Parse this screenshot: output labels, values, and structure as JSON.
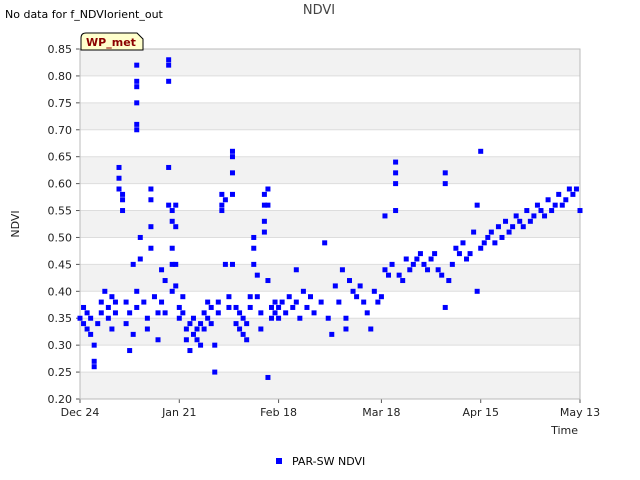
{
  "notice": "No data for f_NDVIorient_out",
  "badge": "WP_met",
  "colors": {
    "series": "#0000ff",
    "band": "#f2f2f2",
    "grid": "#dddddd",
    "badge_bg": "#ffffcc"
  },
  "chart_data": {
    "type": "scatter",
    "title": "NDVI",
    "xlabel": "Time",
    "ylabel": "NDVI",
    "ylim": [
      0.2,
      0.85
    ],
    "yticks": [
      "0.20",
      "0.25",
      "0.30",
      "0.35",
      "0.40",
      "0.45",
      "0.50",
      "0.55",
      "0.60",
      "0.65",
      "0.70",
      "0.75",
      "0.80",
      "0.85"
    ],
    "xlim": [
      "2023-12-24",
      "2024-05-13"
    ],
    "xticks": [
      {
        "date": "2023-12-24",
        "label": "Dec 24"
      },
      {
        "date": "2024-01-21",
        "label": "Jan 21"
      },
      {
        "date": "2024-02-18",
        "label": "Feb 18"
      },
      {
        "date": "2024-03-18",
        "label": "Mar 18"
      },
      {
        "date": "2024-04-15",
        "label": "Apr 15"
      },
      {
        "date": "2024-05-13",
        "label": "May 13"
      }
    ],
    "grid": true,
    "legend_position": "bottom-center",
    "series": [
      {
        "name": "PAR-SW NDVI",
        "points": [
          [
            "2023-12-24",
            0.35
          ],
          [
            "2023-12-25",
            0.34
          ],
          [
            "2023-12-25",
            0.37
          ],
          [
            "2023-12-26",
            0.33
          ],
          [
            "2023-12-26",
            0.36
          ],
          [
            "2023-12-27",
            0.32
          ],
          [
            "2023-12-27",
            0.35
          ],
          [
            "2023-12-28",
            0.3
          ],
          [
            "2023-12-28",
            0.27
          ],
          [
            "2023-12-28",
            0.26
          ],
          [
            "2023-12-29",
            0.34
          ],
          [
            "2023-12-30",
            0.36
          ],
          [
            "2023-12-30",
            0.38
          ],
          [
            "2023-12-31",
            0.4
          ],
          [
            "2024-01-01",
            0.35
          ],
          [
            "2024-01-01",
            0.37
          ],
          [
            "2024-01-02",
            0.39
          ],
          [
            "2024-01-02",
            0.33
          ],
          [
            "2024-01-03",
            0.36
          ],
          [
            "2024-01-03",
            0.38
          ],
          [
            "2024-01-04",
            0.63
          ],
          [
            "2024-01-04",
            0.61
          ],
          [
            "2024-01-04",
            0.59
          ],
          [
            "2024-01-05",
            0.57
          ],
          [
            "2024-01-05",
            0.55
          ],
          [
            "2024-01-05",
            0.58
          ],
          [
            "2024-01-06",
            0.38
          ],
          [
            "2024-01-06",
            0.34
          ],
          [
            "2024-01-07",
            0.36
          ],
          [
            "2024-01-07",
            0.29
          ],
          [
            "2024-01-08",
            0.32
          ],
          [
            "2024-01-08",
            0.45
          ],
          [
            "2024-01-09",
            0.37
          ],
          [
            "2024-01-09",
            0.4
          ],
          [
            "2024-01-09",
            0.82
          ],
          [
            "2024-01-09",
            0.79
          ],
          [
            "2024-01-09",
            0.78
          ],
          [
            "2024-01-09",
            0.75
          ],
          [
            "2024-01-09",
            0.71
          ],
          [
            "2024-01-09",
            0.7
          ],
          [
            "2024-01-10",
            0.5
          ],
          [
            "2024-01-10",
            0.46
          ],
          [
            "2024-01-11",
            0.38
          ],
          [
            "2024-01-12",
            0.35
          ],
          [
            "2024-01-12",
            0.33
          ],
          [
            "2024-01-13",
            0.59
          ],
          [
            "2024-01-13",
            0.57
          ],
          [
            "2024-01-13",
            0.52
          ],
          [
            "2024-01-13",
            0.48
          ],
          [
            "2024-01-14",
            0.39
          ],
          [
            "2024-01-15",
            0.31
          ],
          [
            "2024-01-15",
            0.36
          ],
          [
            "2024-01-16",
            0.44
          ],
          [
            "2024-01-16",
            0.38
          ],
          [
            "2024-01-17",
            0.42
          ],
          [
            "2024-01-17",
            0.36
          ],
          [
            "2024-01-18",
            0.83
          ],
          [
            "2024-01-18",
            0.82
          ],
          [
            "2024-01-18",
            0.79
          ],
          [
            "2024-01-18",
            0.63
          ],
          [
            "2024-01-18",
            0.56
          ],
          [
            "2024-01-19",
            0.55
          ],
          [
            "2024-01-19",
            0.53
          ],
          [
            "2024-01-19",
            0.48
          ],
          [
            "2024-01-19",
            0.45
          ],
          [
            "2024-01-19",
            0.4
          ],
          [
            "2024-01-20",
            0.56
          ],
          [
            "2024-01-20",
            0.52
          ],
          [
            "2024-01-20",
            0.45
          ],
          [
            "2024-01-20",
            0.41
          ],
          [
            "2024-01-21",
            0.37
          ],
          [
            "2024-01-21",
            0.35
          ],
          [
            "2024-01-22",
            0.39
          ],
          [
            "2024-01-22",
            0.36
          ],
          [
            "2024-01-23",
            0.33
          ],
          [
            "2024-01-23",
            0.31
          ],
          [
            "2024-01-24",
            0.34
          ],
          [
            "2024-01-24",
            0.29
          ],
          [
            "2024-01-25",
            0.32
          ],
          [
            "2024-01-25",
            0.35
          ],
          [
            "2024-01-26",
            0.31
          ],
          [
            "2024-01-26",
            0.33
          ],
          [
            "2024-01-27",
            0.3
          ],
          [
            "2024-01-27",
            0.34
          ],
          [
            "2024-01-28",
            0.36
          ],
          [
            "2024-01-28",
            0.33
          ],
          [
            "2024-01-29",
            0.35
          ],
          [
            "2024-01-29",
            0.38
          ],
          [
            "2024-01-30",
            0.37
          ],
          [
            "2024-01-30",
            0.34
          ],
          [
            "2024-01-31",
            0.3
          ],
          [
            "2024-01-31",
            0.25
          ],
          [
            "2024-02-01",
            0.38
          ],
          [
            "2024-02-01",
            0.36
          ],
          [
            "2024-02-02",
            0.58
          ],
          [
            "2024-02-02",
            0.56
          ],
          [
            "2024-02-02",
            0.55
          ],
          [
            "2024-02-03",
            0.57
          ],
          [
            "2024-02-03",
            0.45
          ],
          [
            "2024-02-04",
            0.39
          ],
          [
            "2024-02-04",
            0.37
          ],
          [
            "2024-02-05",
            0.66
          ],
          [
            "2024-02-05",
            0.65
          ],
          [
            "2024-02-05",
            0.62
          ],
          [
            "2024-02-05",
            0.58
          ],
          [
            "2024-02-05",
            0.45
          ],
          [
            "2024-02-06",
            0.37
          ],
          [
            "2024-02-06",
            0.34
          ],
          [
            "2024-02-07",
            0.33
          ],
          [
            "2024-02-07",
            0.36
          ],
          [
            "2024-02-08",
            0.35
          ],
          [
            "2024-02-08",
            0.32
          ],
          [
            "2024-02-09",
            0.31
          ],
          [
            "2024-02-09",
            0.34
          ],
          [
            "2024-02-10",
            0.37
          ],
          [
            "2024-02-10",
            0.39
          ],
          [
            "2024-02-11",
            0.5
          ],
          [
            "2024-02-11",
            0.48
          ],
          [
            "2024-02-11",
            0.45
          ],
          [
            "2024-02-12",
            0.43
          ],
          [
            "2024-02-12",
            0.39
          ],
          [
            "2024-02-13",
            0.36
          ],
          [
            "2024-02-13",
            0.33
          ],
          [
            "2024-02-14",
            0.58
          ],
          [
            "2024-02-14",
            0.56
          ],
          [
            "2024-02-14",
            0.53
          ],
          [
            "2024-02-14",
            0.51
          ],
          [
            "2024-02-15",
            0.59
          ],
          [
            "2024-02-15",
            0.56
          ],
          [
            "2024-02-15",
            0.42
          ],
          [
            "2024-02-15",
            0.24
          ],
          [
            "2024-02-16",
            0.37
          ],
          [
            "2024-02-16",
            0.35
          ],
          [
            "2024-02-17",
            0.36
          ],
          [
            "2024-02-17",
            0.38
          ],
          [
            "2024-02-18",
            0.35
          ],
          [
            "2024-02-18",
            0.37
          ],
          [
            "2024-02-19",
            0.38
          ],
          [
            "2024-02-20",
            0.36
          ],
          [
            "2024-02-21",
            0.39
          ],
          [
            "2024-02-22",
            0.37
          ],
          [
            "2024-02-23",
            0.44
          ],
          [
            "2024-02-23",
            0.38
          ],
          [
            "2024-02-24",
            0.35
          ],
          [
            "2024-02-25",
            0.4
          ],
          [
            "2024-02-26",
            0.37
          ],
          [
            "2024-02-27",
            0.39
          ],
          [
            "2024-02-28",
            0.36
          ],
          [
            "2024-03-01",
            0.38
          ],
          [
            "2024-03-02",
            0.49
          ],
          [
            "2024-03-03",
            0.35
          ],
          [
            "2024-03-04",
            0.32
          ],
          [
            "2024-03-05",
            0.41
          ],
          [
            "2024-03-06",
            0.38
          ],
          [
            "2024-03-07",
            0.44
          ],
          [
            "2024-03-08",
            0.35
          ],
          [
            "2024-03-08",
            0.33
          ],
          [
            "2024-03-09",
            0.42
          ],
          [
            "2024-03-10",
            0.4
          ],
          [
            "2024-03-11",
            0.39
          ],
          [
            "2024-03-12",
            0.41
          ],
          [
            "2024-03-13",
            0.38
          ],
          [
            "2024-03-14",
            0.36
          ],
          [
            "2024-03-15",
            0.33
          ],
          [
            "2024-03-16",
            0.4
          ],
          [
            "2024-03-17",
            0.38
          ],
          [
            "2024-03-18",
            0.39
          ],
          [
            "2024-03-19",
            0.44
          ],
          [
            "2024-03-19",
            0.54
          ],
          [
            "2024-03-20",
            0.43
          ],
          [
            "2024-03-21",
            0.45
          ],
          [
            "2024-03-22",
            0.64
          ],
          [
            "2024-03-22",
            0.62
          ],
          [
            "2024-03-22",
            0.55
          ],
          [
            "2024-03-22",
            0.6
          ],
          [
            "2024-03-23",
            0.43
          ],
          [
            "2024-03-24",
            0.42
          ],
          [
            "2024-03-25",
            0.46
          ],
          [
            "2024-03-26",
            0.44
          ],
          [
            "2024-03-27",
            0.45
          ],
          [
            "2024-03-28",
            0.46
          ],
          [
            "2024-03-29",
            0.47
          ],
          [
            "2024-03-30",
            0.45
          ],
          [
            "2024-03-31",
            0.44
          ],
          [
            "2024-04-01",
            0.46
          ],
          [
            "2024-04-02",
            0.47
          ],
          [
            "2024-04-03",
            0.44
          ],
          [
            "2024-04-04",
            0.43
          ],
          [
            "2024-04-05",
            0.62
          ],
          [
            "2024-04-05",
            0.6
          ],
          [
            "2024-04-05",
            0.37
          ],
          [
            "2024-04-06",
            0.42
          ],
          [
            "2024-04-07",
            0.45
          ],
          [
            "2024-04-08",
            0.48
          ],
          [
            "2024-04-09",
            0.47
          ],
          [
            "2024-04-10",
            0.49
          ],
          [
            "2024-04-11",
            0.46
          ],
          [
            "2024-04-12",
            0.47
          ],
          [
            "2024-04-13",
            0.51
          ],
          [
            "2024-04-14",
            0.56
          ],
          [
            "2024-04-14",
            0.4
          ],
          [
            "2024-04-15",
            0.48
          ],
          [
            "2024-04-15",
            0.66
          ],
          [
            "2024-04-16",
            0.49
          ],
          [
            "2024-04-17",
            0.5
          ],
          [
            "2024-04-18",
            0.51
          ],
          [
            "2024-04-19",
            0.49
          ],
          [
            "2024-04-20",
            0.52
          ],
          [
            "2024-04-21",
            0.5
          ],
          [
            "2024-04-22",
            0.53
          ],
          [
            "2024-04-23",
            0.51
          ],
          [
            "2024-04-24",
            0.52
          ],
          [
            "2024-04-25",
            0.54
          ],
          [
            "2024-04-26",
            0.53
          ],
          [
            "2024-04-27",
            0.52
          ],
          [
            "2024-04-28",
            0.55
          ],
          [
            "2024-04-29",
            0.53
          ],
          [
            "2024-04-30",
            0.54
          ],
          [
            "2024-05-01",
            0.56
          ],
          [
            "2024-05-02",
            0.55
          ],
          [
            "2024-05-03",
            0.54
          ],
          [
            "2024-05-04",
            0.57
          ],
          [
            "2024-05-05",
            0.55
          ],
          [
            "2024-05-06",
            0.56
          ],
          [
            "2024-05-07",
            0.58
          ],
          [
            "2024-05-08",
            0.56
          ],
          [
            "2024-05-09",
            0.57
          ],
          [
            "2024-05-10",
            0.59
          ],
          [
            "2024-05-11",
            0.58
          ],
          [
            "2024-05-12",
            0.59
          ],
          [
            "2024-05-13",
            0.55
          ]
        ]
      }
    ]
  }
}
